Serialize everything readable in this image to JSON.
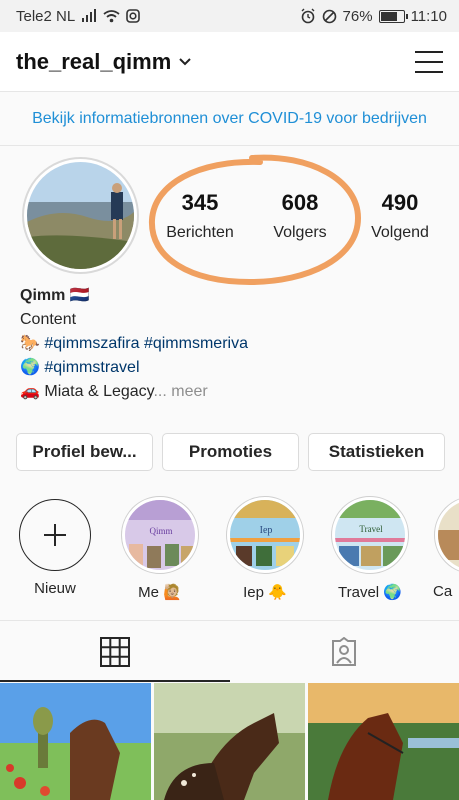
{
  "statusbar": {
    "carrier": "Tele2 NL",
    "battery": "76%",
    "battery_level": 0.76,
    "time": "11:10"
  },
  "header": {
    "username": "the_real_qimm"
  },
  "banner": {
    "text": "Bekijk informatiebronnen over COVID-19 voor bedrijven"
  },
  "profile": {
    "stats": [
      {
        "value": "345",
        "label": "Berichten"
      },
      {
        "value": "608",
        "label": "Volgers"
      },
      {
        "value": "490",
        "label": "Volgend"
      }
    ],
    "name": "Qimm",
    "name_flag": "🇳🇱",
    "category": "Content",
    "bio_line1_emoji": "🐎",
    "bio_line1": "#qimmszafira #qimmsmeriva",
    "bio_line2_emoji": "🌍",
    "bio_line2": "#qimmstravel",
    "bio_line3_emoji": "🚗",
    "bio_line3": "Miata & Legacy",
    "more": "... meer"
  },
  "buttons": {
    "edit": "Profiel bew...",
    "promotions": "Promoties",
    "insights": "Statistieken"
  },
  "highlights": [
    {
      "label": "Nieuw"
    },
    {
      "label": "Me 🙋🏼",
      "cover_text": "Qimm"
    },
    {
      "label": "Iep 🐥",
      "cover_text": "Iep"
    },
    {
      "label": "Travel 🌍",
      "cover_text": "Travel"
    },
    {
      "label": "Ca"
    }
  ],
  "tabs": [
    {
      "icon": "grid-icon",
      "active": true
    },
    {
      "icon": "tagged-user-icon",
      "active": false
    }
  ],
  "colors": {
    "link": "#1f8fd6",
    "hashtag": "#00376b",
    "annotation": "#f0a060"
  }
}
